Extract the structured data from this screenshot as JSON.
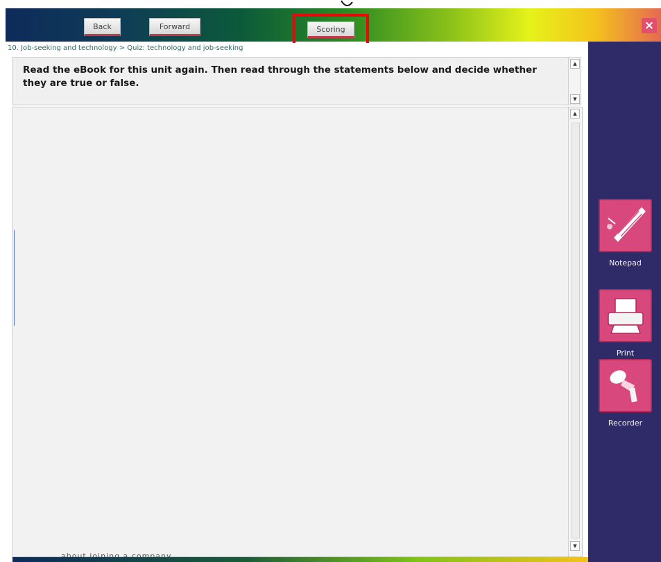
{
  "toolbar": {
    "back_label": "Back",
    "forward_label": "Forward",
    "scoring_label": "Scoring",
    "close_label": "×"
  },
  "breadcrumb": {
    "text": "10. Job-seeking and technology > Quiz: technology and job-seeking"
  },
  "instruction": {
    "text": "Read the eBook for this unit again. Then read through the statements below and decide whether they are true or false."
  },
  "content": {
    "cut_off_text": "about joining a company"
  },
  "sidebar": {
    "tools": [
      {
        "label": "Notepad",
        "icon": "notepad-icon"
      },
      {
        "label": "Print",
        "icon": "printer-icon"
      },
      {
        "label": "Recorder",
        "icon": "microphone-icon"
      }
    ]
  },
  "colors": {
    "accent": "#d9487c",
    "sidebar_bg": "#2f2b68",
    "highlight": "#e60a0a"
  }
}
